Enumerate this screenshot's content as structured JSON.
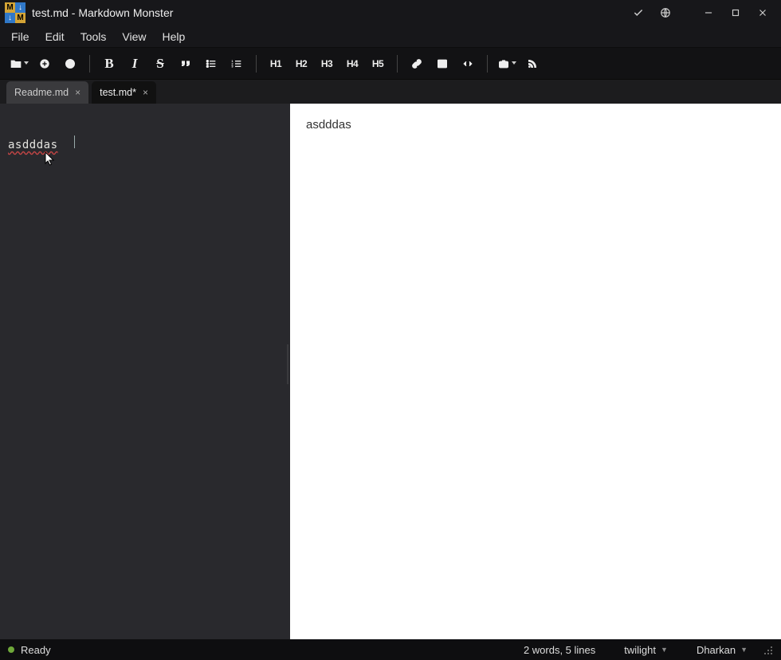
{
  "title": "test.md  - Markdown Monster",
  "menus": [
    "File",
    "Edit",
    "Tools",
    "View",
    "Help"
  ],
  "toolbar": {
    "headings": [
      "H1",
      "H2",
      "H3",
      "H4",
      "H5"
    ]
  },
  "tabs": [
    {
      "label": "Readme.md",
      "active": false
    },
    {
      "label": "test.md*",
      "active": true
    }
  ],
  "editor": {
    "content": "asdddas"
  },
  "preview": {
    "content": "asdddas"
  },
  "status": {
    "ready": "Ready",
    "stats": "2 words, 5 lines",
    "theme": "twilight",
    "preview_theme": "Dharkan"
  }
}
